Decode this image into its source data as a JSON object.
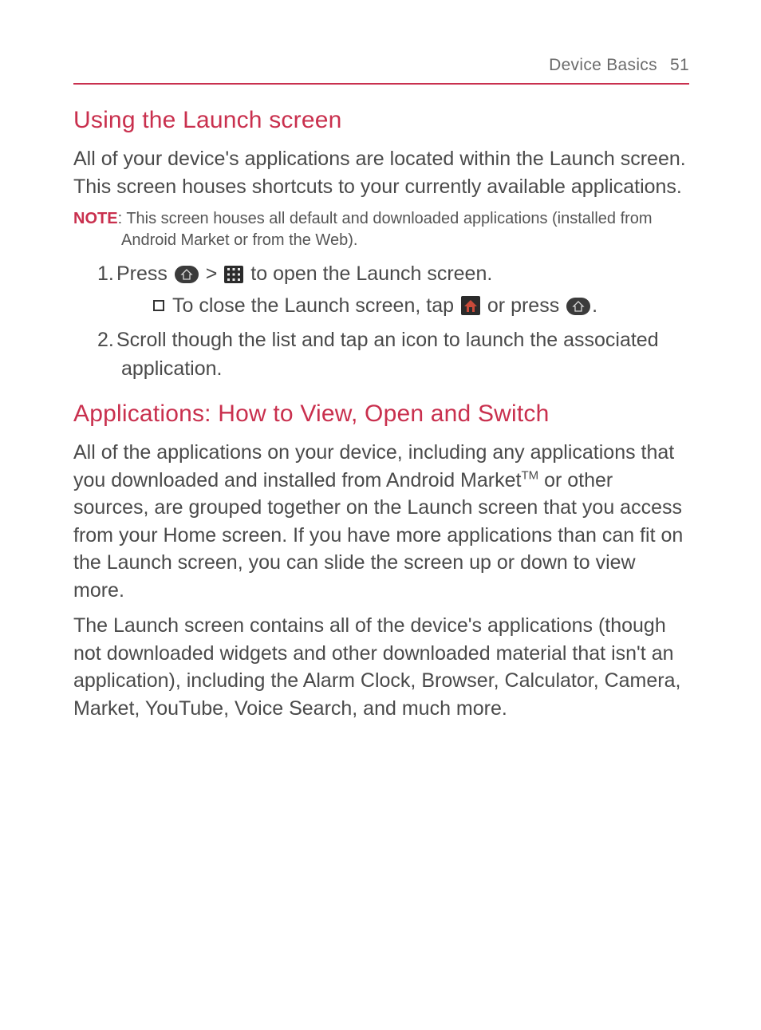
{
  "header": {
    "section": "Device Basics",
    "page": "51"
  },
  "sections": [
    {
      "heading": "Using the Launch screen",
      "intro": "All of your device's applications are located within the Launch screen. This screen houses shortcuts to your currently available applications.",
      "note_label": "NOTE",
      "note": ": This screen houses all default and downloaded applications (installed from Android Market or from the Web).",
      "steps": {
        "s1_pre": "Press ",
        "s1_mid": " > ",
        "s1_post": " to open the Launch screen.",
        "s1_sub_pre": "To close the Launch screen, tap ",
        "s1_sub_mid": " or press ",
        "s1_sub_post": ".",
        "s2": "Scroll though the list and tap an icon to launch the associated application."
      }
    },
    {
      "heading": "Applications: How to View, Open and Switch",
      "p1_pre": "All of the applications on your device, including any applications that you downloaded and installed from Android Market",
      "p1_tm": "TM",
      "p1_post": " or other sources, are grouped together on the Launch screen that you access from your Home screen. If you have more applications than can fit on the Launch screen, you can slide the screen up or down to view more.",
      "p2": "The Launch screen contains all of the device's applications (though not downloaded widgets and other downloaded material that isn't an application), including the Alarm Clock, Browser, Calculator, Camera, Market, YouTube, Voice Search, and much more."
    }
  ],
  "icons": {
    "home_btn": "home-button-icon",
    "apps_grid": "apps-grid-icon",
    "home_soft": "home-soft-icon"
  }
}
